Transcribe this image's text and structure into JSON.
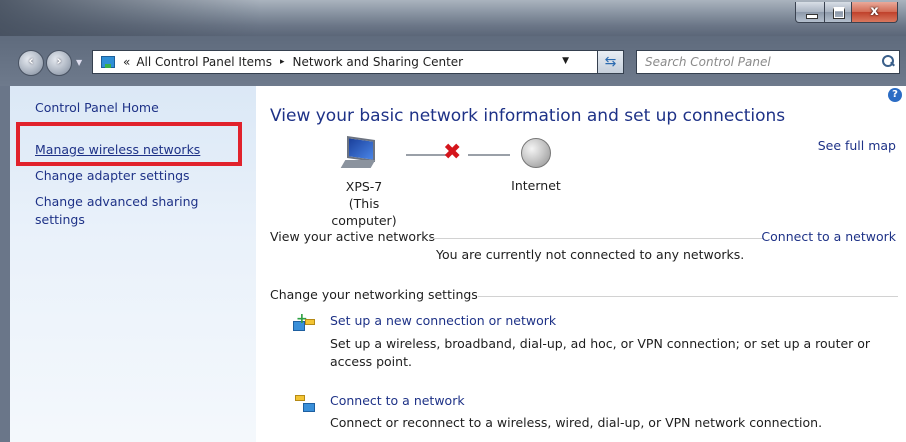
{
  "window": {
    "controls": {
      "minimize": "",
      "maximize": "",
      "close": "x"
    }
  },
  "nav": {
    "back_icon": "back-arrow-icon",
    "forward_icon": "forward-arrow-icon",
    "address": {
      "prefix": "«",
      "crumbs": [
        "All Control Panel Items",
        "Network and Sharing Center"
      ],
      "separator": "▸"
    },
    "search_placeholder": "Search Control Panel"
  },
  "sidebar": {
    "home": "Control Panel Home",
    "items": [
      {
        "label": "Manage wireless networks",
        "highlighted": true
      },
      {
        "label": "Change adapter settings"
      },
      {
        "label": "Change advanced sharing settings"
      }
    ],
    "highlight_color": "#e1222c"
  },
  "main": {
    "help_icon": "?",
    "title": "View your basic network information and set up connections",
    "map": {
      "computer_name": "XPS-7",
      "computer_sub": "(This computer)",
      "internet_label": "Internet",
      "status_icon": "✖",
      "see_full_map": "See full map"
    },
    "active_networks": {
      "heading": "View your active networks",
      "link": "Connect to a network",
      "status": "You are currently not connected to any networks."
    },
    "settings": {
      "heading": "Change your networking settings",
      "tasks": [
        {
          "title": "Set up a new connection or network",
          "desc": "Set up a wireless, broadband, dial-up, ad hoc, or VPN connection; or set up a router or access point."
        },
        {
          "title": "Connect to a network",
          "desc": "Connect or reconnect to a wireless, wired, dial-up, or VPN network connection."
        }
      ]
    }
  },
  "colors": {
    "link": "#1e3287",
    "sidebar_bg": "#dbe8f6",
    "error_red": "#d4151c"
  }
}
